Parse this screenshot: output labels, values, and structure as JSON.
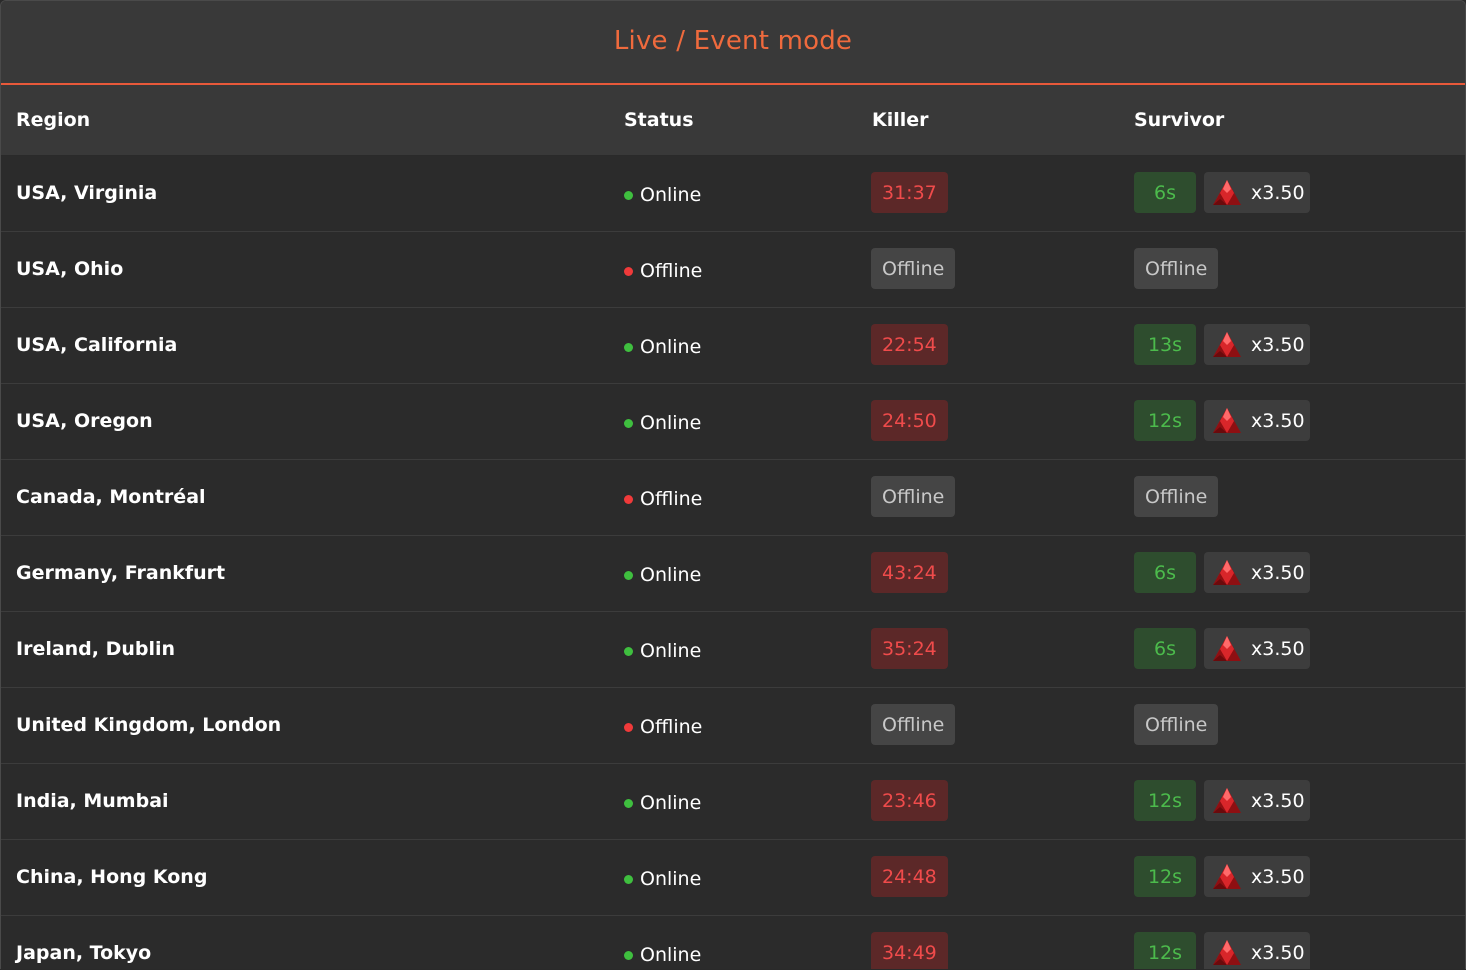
{
  "title": "Live / Event mode",
  "colors": {
    "accent": "#ef6a3d",
    "online_dot": "#3fbf3f",
    "offline_dot": "#f03a3a",
    "killer_time_bg": "#5c2828",
    "killer_time_text": "#f04b4b",
    "survivor_time_bg": "#2e4d2e",
    "survivor_time_text": "#4cbb4c"
  },
  "columns": {
    "region": "Region",
    "status": "Status",
    "killer": "Killer",
    "survivor": "Survivor"
  },
  "rows": [
    {
      "region": "USA, Virginia",
      "status": "Online",
      "online": true,
      "killer": "31:37",
      "survivor": "6s",
      "multiplier": "x3.50",
      "icon": "red-shard-icon"
    },
    {
      "region": "USA, Ohio",
      "status": "Offline",
      "online": false,
      "killer": "Offline",
      "survivor": "Offline"
    },
    {
      "region": "USA, California",
      "status": "Online",
      "online": true,
      "killer": "22:54",
      "survivor": "13s",
      "multiplier": "x3.50",
      "icon": "red-shard-icon"
    },
    {
      "region": "USA, Oregon",
      "status": "Online",
      "online": true,
      "killer": "24:50",
      "survivor": "12s",
      "multiplier": "x3.50",
      "icon": "red-shard-icon"
    },
    {
      "region": "Canada, Montréal",
      "status": "Offline",
      "online": false,
      "killer": "Offline",
      "survivor": "Offline"
    },
    {
      "region": "Germany, Frankfurt",
      "status": "Online",
      "online": true,
      "killer": "43:24",
      "survivor": "6s",
      "multiplier": "x3.50",
      "icon": "red-shard-icon"
    },
    {
      "region": "Ireland, Dublin",
      "status": "Online",
      "online": true,
      "killer": "35:24",
      "survivor": "6s",
      "multiplier": "x3.50",
      "icon": "red-shard-icon"
    },
    {
      "region": "United Kingdom, London",
      "status": "Offline",
      "online": false,
      "killer": "Offline",
      "survivor": "Offline"
    },
    {
      "region": "India, Mumbai",
      "status": "Online",
      "online": true,
      "killer": "23:46",
      "survivor": "12s",
      "multiplier": "x3.50",
      "icon": "red-shard-icon"
    },
    {
      "region": "China, Hong Kong",
      "status": "Online",
      "online": true,
      "killer": "24:48",
      "survivor": "12s",
      "multiplier": "x3.50",
      "icon": "red-shard-icon"
    },
    {
      "region": "Japan, Tokyo",
      "status": "Online",
      "online": true,
      "killer": "34:49",
      "survivor": "12s",
      "multiplier": "x3.50",
      "icon": "red-shard-icon"
    }
  ]
}
